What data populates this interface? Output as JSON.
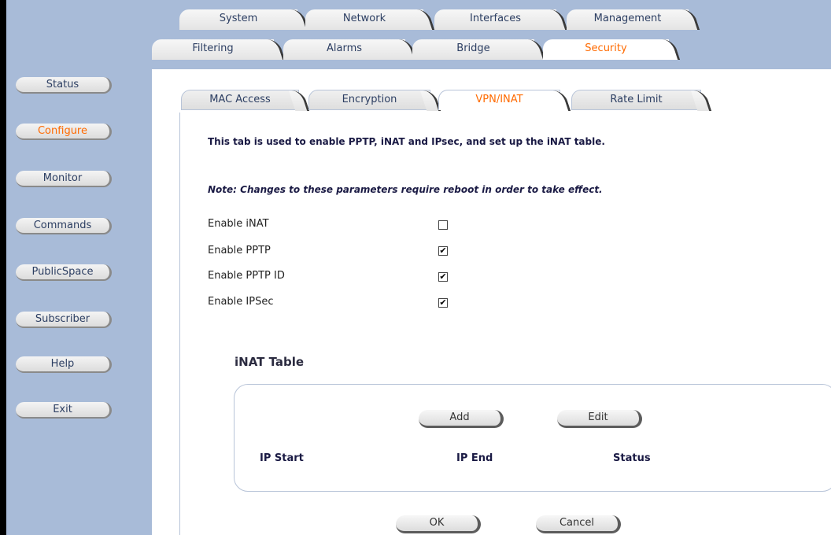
{
  "sidebar": {
    "items": [
      {
        "label": "Status"
      },
      {
        "label": "Configure"
      },
      {
        "label": "Monitor"
      },
      {
        "label": "Commands"
      },
      {
        "label": "PublicSpace"
      },
      {
        "label": "Subscriber"
      },
      {
        "label": "Help"
      },
      {
        "label": "Exit"
      }
    ],
    "active": "Configure"
  },
  "tabs_row1": [
    "System",
    "Network",
    "Interfaces",
    "Management"
  ],
  "tabs_row2": {
    "items": [
      "Filtering",
      "Alarms",
      "Bridge",
      "Security"
    ],
    "active": "Security"
  },
  "tabs_row3": {
    "items": [
      "MAC Access",
      "Encryption",
      "VPN/INAT",
      "Rate Limit"
    ],
    "active": "VPN/INAT"
  },
  "main": {
    "description": "This tab is used to enable PPTP, iNAT and IPsec, and set up the iNAT table.",
    "note": "Note: Changes to these parameters require reboot in order to take effect.",
    "fields": [
      {
        "label": "Enable iNAT",
        "checked": false
      },
      {
        "label": "Enable PPTP",
        "checked": true
      },
      {
        "label": "Enable PPTP ID",
        "checked": true
      },
      {
        "label": "Enable IPSec",
        "checked": true
      }
    ],
    "table": {
      "title": "iNAT Table",
      "add_label": "Add",
      "edit_label": "Edit",
      "columns": [
        "IP Start",
        "IP End",
        "Status"
      ]
    },
    "ok_label": "OK",
    "cancel_label": "Cancel"
  },
  "colors": {
    "sidebar_bg": "#a8bbd8",
    "active_text": "#ff6a00",
    "text_dark": "#1a1a44"
  }
}
